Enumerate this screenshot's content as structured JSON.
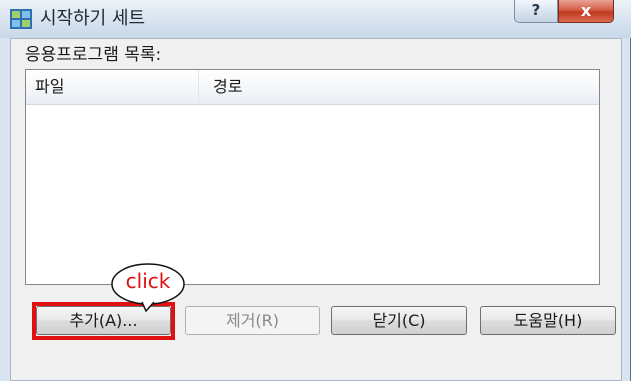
{
  "window": {
    "title": "시작하기 세트",
    "help_label": "?",
    "close_label": "x"
  },
  "content": {
    "list_label": "응용프로그램 목록:",
    "columns": [
      "파일",
      "경로"
    ]
  },
  "buttons": {
    "add": "추가(A)...",
    "remove": "제거(R)",
    "close": "닫기(C)",
    "help": "도움말(H)"
  },
  "annotation": {
    "callout_text": "click",
    "color": "#e01010"
  }
}
